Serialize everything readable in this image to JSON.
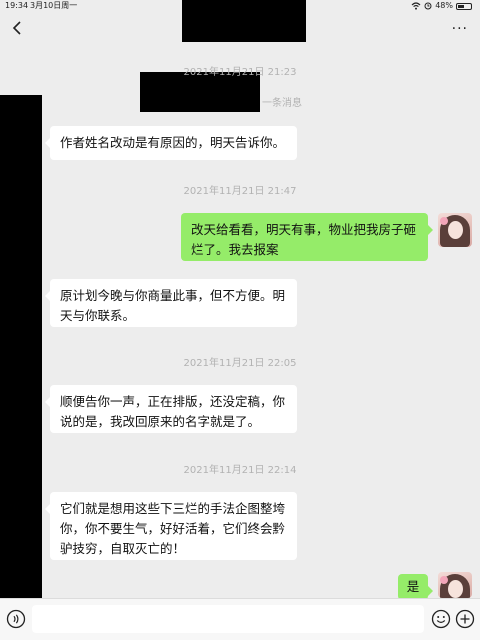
{
  "status_bar": {
    "time": "19:34",
    "date": "3月10日周一",
    "battery": "48%",
    "battery_level": 0.48
  },
  "header": {
    "back_icon": "chevron-left-icon",
    "more_label": "···"
  },
  "notice": "一条消息",
  "messages": [
    {
      "kind": "timestamp",
      "text": "2021年11月21日 21:23"
    },
    {
      "kind": "in",
      "text": "作者姓名改动是有原因的，明天告诉你。"
    },
    {
      "kind": "timestamp",
      "text": "2021年11月21日 21:47"
    },
    {
      "kind": "out",
      "lines": [
        "改天给看看，明天有事，物业把我房子砸",
        "烂了。我去报案"
      ]
    },
    {
      "kind": "in",
      "lines": [
        "原计划今晚与你商量此事，但不方便。明",
        "天与你联系。"
      ]
    },
    {
      "kind": "timestamp",
      "text": "2021年11月21日 22:05"
    },
    {
      "kind": "in",
      "lines": [
        "顺便告你一声，正在排版，还没定稿，你",
        "说的是，我改回原来的名字就是了。"
      ]
    },
    {
      "kind": "timestamp",
      "text": "2021年11月21日 22:14"
    },
    {
      "kind": "in",
      "lines": [
        "它们就是想用这些下三烂的手法企图整垮",
        "你，你不要生气，好好活着，它们终会黔",
        "驴技穷，自取灭亡的！"
      ]
    },
    {
      "kind": "out",
      "text": "是"
    }
  ],
  "input_bar": {
    "voice_icon": "voice-icon",
    "emoji_icon": "emoji-icon",
    "plus_icon": "plus-icon",
    "input_value": ""
  },
  "colors": {
    "background": "#ededed",
    "incoming_bubble": "#ffffff",
    "outgoing_bubble": "#95ec69",
    "timestamp": "#b2b2b2",
    "redaction": "#000000"
  }
}
